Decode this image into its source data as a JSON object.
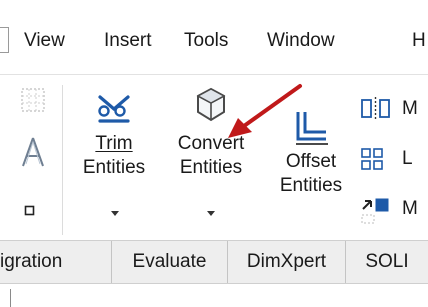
{
  "menu": {
    "stub_label": "I",
    "items": [
      "View",
      "Insert",
      "Tools",
      "Window",
      "H"
    ]
  },
  "ribbon": {
    "commands": {
      "trim": {
        "line1": "Trim",
        "line2": "Entities",
        "mnemonic": "T"
      },
      "convert": {
        "line1": "Convert",
        "line2": "Entities"
      },
      "offset": {
        "line1": "Offset",
        "line2": "Entities"
      }
    },
    "right_column": [
      "M",
      "L",
      "M"
    ],
    "icons": {
      "left_top": "sketch-grid-icon",
      "left_middle": "text-icon",
      "left_bottom": "small-square-icon",
      "trim": "trim-entities-icon",
      "convert": "convert-entities-icon",
      "offset": "offset-entities-icon",
      "right_top": "mirror-entities-icon",
      "right_middle": "linear-pattern-icon",
      "right_bottom": "move-entities-icon"
    }
  },
  "tabs": [
    "igration",
    "Evaluate",
    "DimXpert",
    "SOLI"
  ],
  "annotation": {
    "arrow_color": "#c0191a"
  },
  "colors": {
    "icon_blue": "#1e5aa8",
    "icon_dark": "#333333",
    "tab_bg": "#eeeeee"
  }
}
